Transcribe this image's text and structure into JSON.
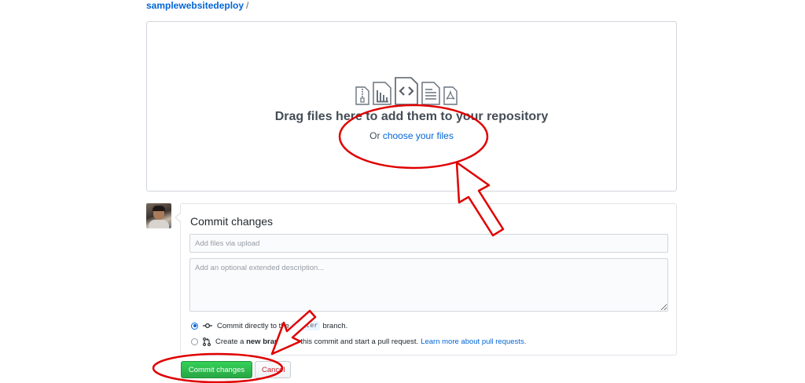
{
  "breadcrumb": {
    "repo": "samplewebsitedeploy",
    "separator": "/"
  },
  "dropzone": {
    "title": "Drag files here to add them to your repository",
    "or_text": "Or",
    "choose_link": "choose your files",
    "icons": [
      "zip-file-icon",
      "chart-file-icon",
      "code-file-icon",
      "text-file-icon",
      "pdf-file-icon"
    ]
  },
  "commit": {
    "title": "Commit changes",
    "summary_placeholder": "Add files via upload",
    "description_placeholder": "Add an optional extended description...",
    "option_direct": {
      "prefix": "Commit directly to the",
      "branch": "master",
      "suffix": "branch."
    },
    "option_new": {
      "prefix": "Create a",
      "bold": "new branch",
      "suffix": "for this commit and start a pull request.",
      "link": "Learn more about pull requests."
    },
    "commit_button": "Commit changes",
    "cancel_button": "Cancel"
  },
  "colors": {
    "link": "#0366d6",
    "commit_button": "#28a745",
    "cancel_text": "#cb2431",
    "annotation": "#e00000"
  }
}
